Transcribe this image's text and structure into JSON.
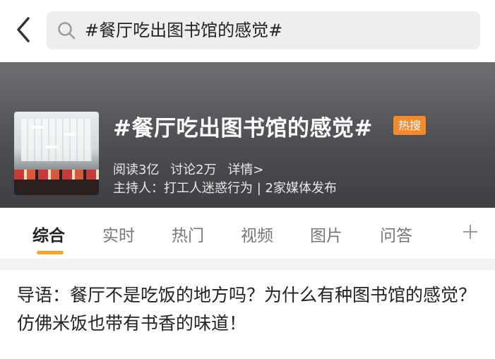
{
  "search": {
    "query": "#餐厅吃出图书馆的感觉#"
  },
  "topic": {
    "title": "#餐厅吃出图书馆的感觉#",
    "badge": "热搜",
    "reads": "阅读3亿",
    "discussions": "讨论2万",
    "details": "详情>",
    "host": "主持人：打工人迷惑行为 | 2家媒体发布"
  },
  "tabs": [
    "综合",
    "实时",
    "热门",
    "视频",
    "图片",
    "问答"
  ],
  "active_tab": "综合",
  "intro": "导语：餐厅不是吃饭的地方吗？为什么有种图书馆的感觉？仿佛米饭也带有书香的味道！",
  "colors": {
    "accent": "#f5a623",
    "badge": "#f58a2c"
  },
  "icons": {
    "back": "chevron-left-icon",
    "search": "search-icon",
    "add": "plus-icon"
  }
}
